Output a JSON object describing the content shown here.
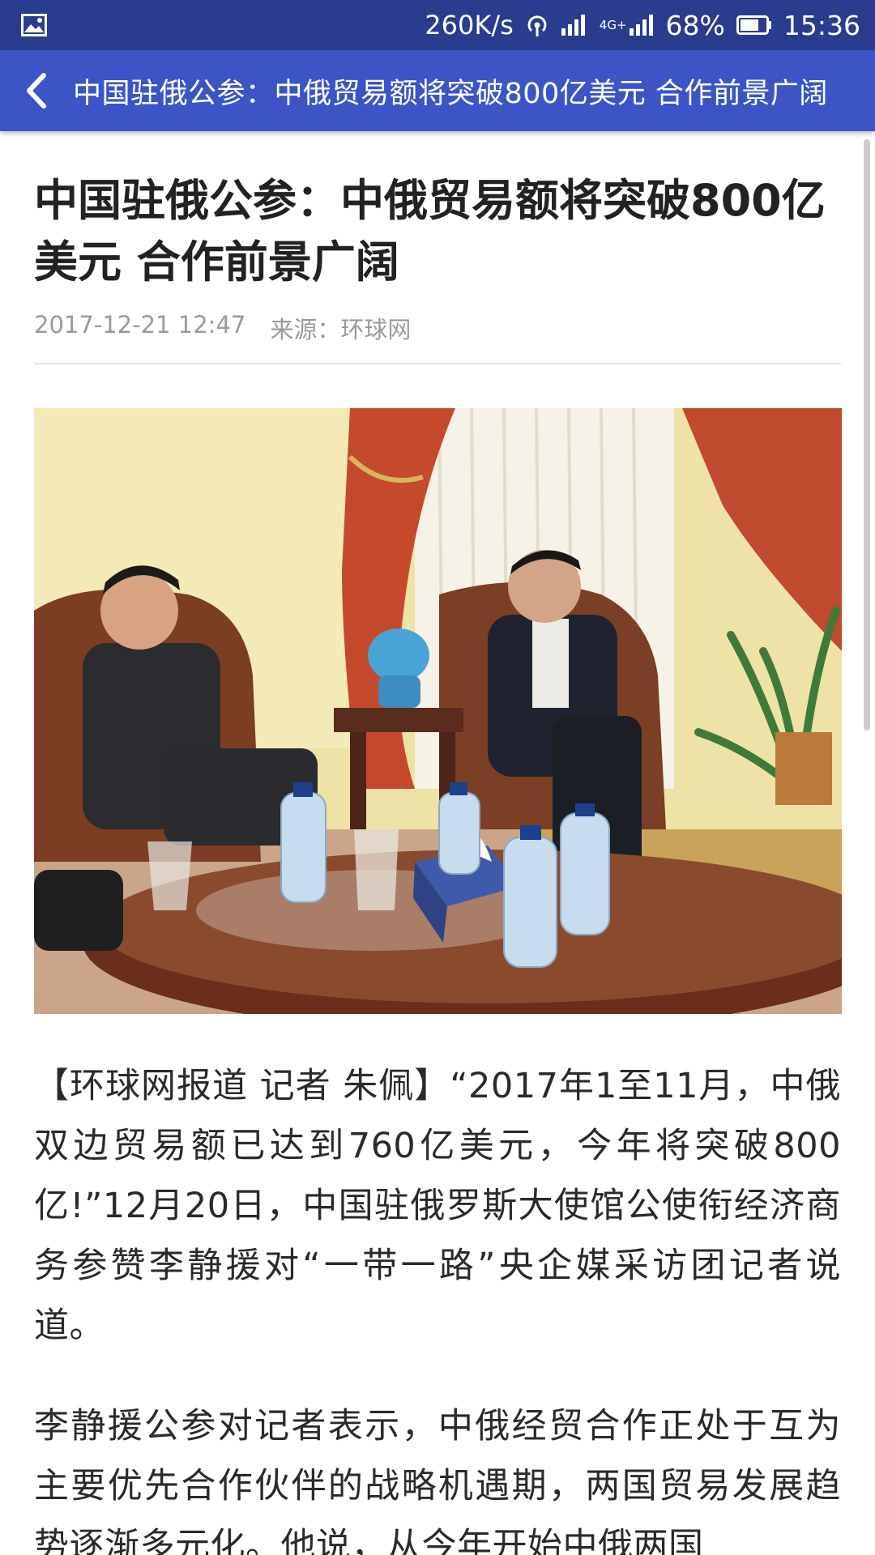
{
  "status_bar": {
    "net_speed": "260K/s",
    "network_type": "4G+",
    "battery": "68%",
    "time": "15:36",
    "icons": [
      "image-icon",
      "hotspot-icon",
      "signal-icon",
      "signal-4g-icon",
      "battery-icon"
    ]
  },
  "toolbar": {
    "title": "中国驻俄公参：中俄贸易额将突破800亿美元 合作前景广阔",
    "back_icon": "chevron-left-icon"
  },
  "article": {
    "title": "中国驻俄公参：中俄贸易额将突破800亿美元 合作前景广阔",
    "date": "2017-12-21 12:47",
    "source": "来源：环球网",
    "paragraphs": [
      "【环球网报道 记者 朱佩】“2017年1至11月，中俄双边贸易额已达到760亿美元，今年将突破800亿!”12月20日，中国驻俄罗斯大使馆公使衔经济商务参赞李静援对“一带一路”央企媒采访团记者说道。",
      "李静援公参对记者表示，中俄经贸合作正处于互为主要优先合作伙伴的战略机遇期，两国贸易发展趋势逐渐多元化。他说，从今年开始中俄两国"
    ]
  },
  "colors": {
    "status_bar": "#2a3c8e",
    "toolbar": "#3b55c7",
    "text": "#2a2a2a",
    "meta": "#9a9a9a"
  }
}
